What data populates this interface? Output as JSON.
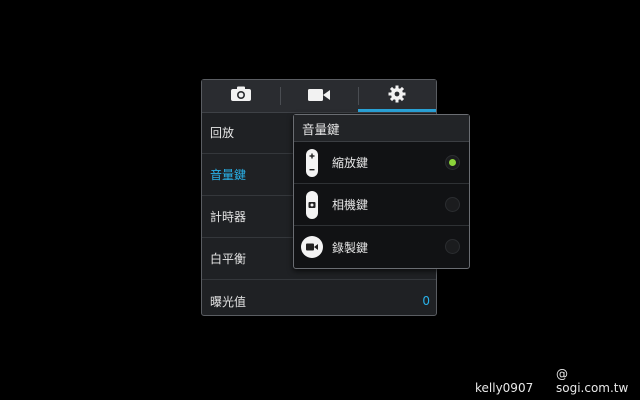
{
  "tabs": [
    {
      "icon": "camera-icon"
    },
    {
      "icon": "video-camera-icon"
    },
    {
      "icon": "gear-icon",
      "active": true
    }
  ],
  "settings": {
    "items": [
      {
        "label": "回放",
        "value": ""
      },
      {
        "label": "音量鍵",
        "value": "",
        "active": true
      },
      {
        "label": "計時器",
        "value": ""
      },
      {
        "label": "白平衡",
        "value": ""
      },
      {
        "label": "曝光值",
        "value": "0"
      }
    ]
  },
  "popup": {
    "title": "音量鍵",
    "options": [
      {
        "label": "縮放鍵",
        "icon": "zoom-key-icon",
        "selected": true
      },
      {
        "label": "相機鍵",
        "icon": "camera-key-icon",
        "selected": false
      },
      {
        "label": "錄製鍵",
        "icon": "record-key-icon",
        "selected": false
      }
    ]
  },
  "watermark": {
    "left": "kelly0907",
    "right": "@ sogi.com.tw"
  },
  "colors": {
    "accent": "#29b2ea",
    "selected_radio": "#8bd43a"
  }
}
